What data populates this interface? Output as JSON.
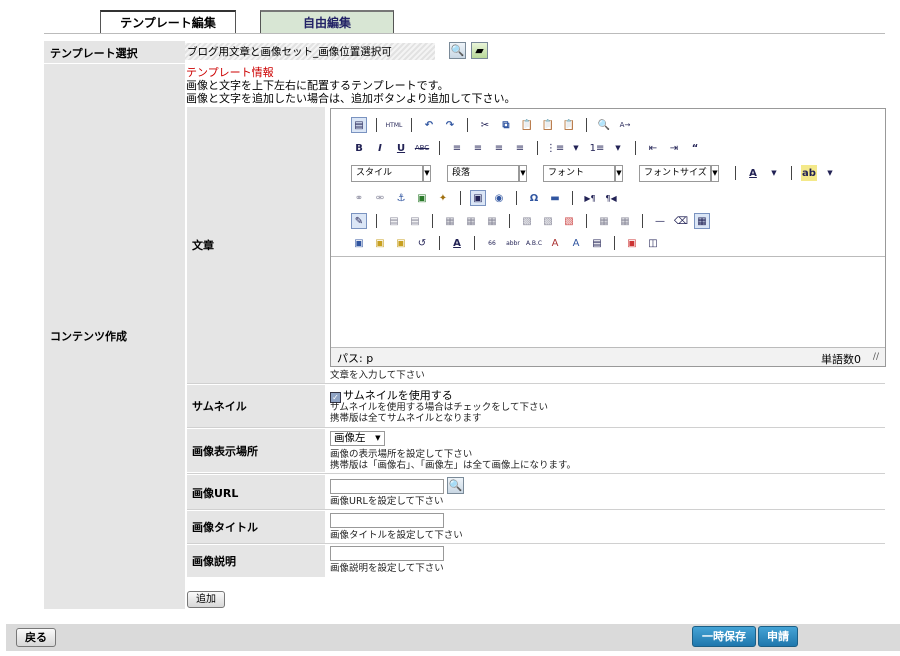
{
  "tabs": {
    "template_edit": "テンプレート編集",
    "free_edit": "自由編集"
  },
  "template_select": {
    "label": "テンプレート選択",
    "value": "ブログ用文章と画像セット_画像位置選択可"
  },
  "content": {
    "label": "コンテンツ作成",
    "info_title": "テンプレート情報",
    "info_line1": "画像と文字を上下左右に配置するテンプレートです。",
    "info_line2": "画像と文字を追加したい場合は、追加ボタンより追加して下さい。"
  },
  "body_text": {
    "label": "文章",
    "toolbar": {
      "style": "スタイル",
      "paragraph": "段落",
      "font": "フォント",
      "font_size": "フォントサイズ"
    },
    "status_path": "パス: p",
    "word_count": "単語数0",
    "help": "文章を入力して下さい"
  },
  "thumbnail": {
    "label": "サムネイル",
    "checkbox_label": "サムネイルを使用する",
    "checked": true,
    "help1": "サムネイルを使用する場合はチェックをして下さい",
    "help2": "携帯版は全てサムネイルとなります"
  },
  "image_position": {
    "label": "画像表示場所",
    "selected": "画像左",
    "help1": "画像の表示場所を設定して下さい",
    "help2": "携帯版は「画像右」、「画像左」は全て画像上になります。"
  },
  "image_url": {
    "label": "画像URL",
    "value": "",
    "help": "画像URLを設定して下さい"
  },
  "image_title": {
    "label": "画像タイトル",
    "value": "",
    "help": "画像タイトルを設定して下さい"
  },
  "image_desc": {
    "label": "画像説明",
    "value": "",
    "help": "画像説明を設定して下さい"
  },
  "add_button": "追加",
  "footer": {
    "back": "戻る",
    "temp_save": "一時保存",
    "apply": "申請"
  }
}
